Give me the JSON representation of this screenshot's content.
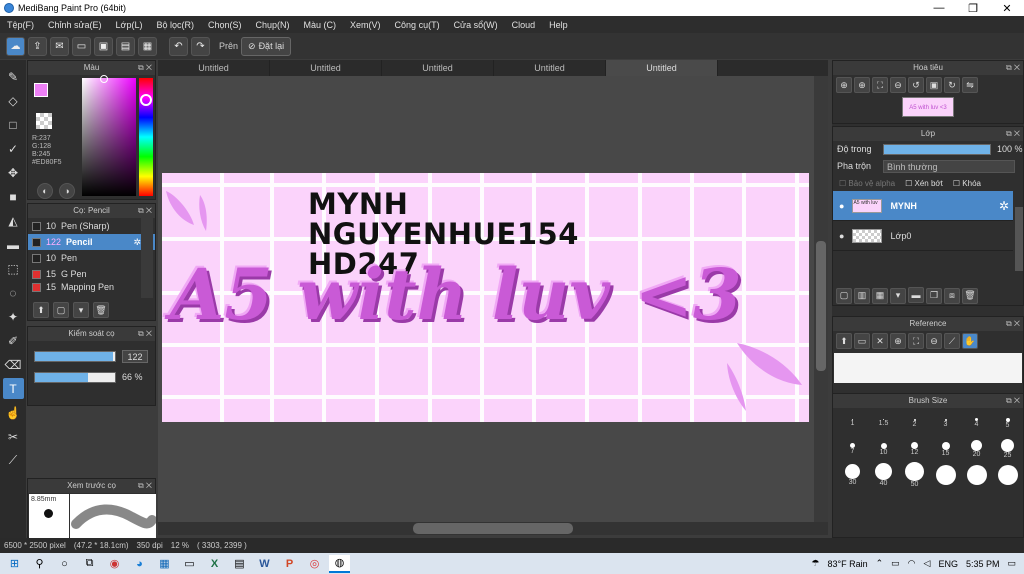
{
  "window": {
    "title": "MediBang Paint Pro (64bit)"
  },
  "menu": [
    "Tệp(F)",
    "Chỉnh sửa(E)",
    "Lớp(L)",
    "Bộ lọc(R)",
    "Chọn(S)",
    "Chụp(N)",
    "Màu (C)",
    "Xem(V)",
    "Công cụ(T)",
    "Cửa sổ(W)",
    "Cloud",
    "Help"
  ],
  "toolbar": {
    "pren": "Prên",
    "reset": "Đặt lại"
  },
  "tabs": [
    "Untitled",
    "Untitled",
    "Untitled",
    "Untitled",
    "Untitled"
  ],
  "color_panel": {
    "title": "Màu",
    "r": "R:237",
    "g": "G:128",
    "b": "B:245",
    "hex": "#ED80F5",
    "fg": "#ED80F5",
    "bg": "#F5C842"
  },
  "brush_panel": {
    "title": "Cọ: Pencil",
    "items": [
      {
        "size": "10",
        "name": "Pen (Sharp)",
        "color": "#222222"
      },
      {
        "size": "122",
        "name": "Pencil",
        "color": "#222222"
      },
      {
        "size": "10",
        "name": "Pen",
        "color": "#222222"
      },
      {
        "size": "15",
        "name": "G Pen",
        "color": "#e03030"
      },
      {
        "size": "15",
        "name": "Mapping Pen",
        "color": "#e03030"
      }
    ]
  },
  "control_panel": {
    "title": "Kiểm soát cọ",
    "size": "122",
    "opacity": "66 %",
    "size_fraction": 0.98,
    "opacity_fraction": 0.66
  },
  "preview_panel": {
    "title": "Xem trước cọ",
    "size": "8.85mm"
  },
  "canvas": {
    "line1": "MYNH",
    "line2": "NGUYENHUE154",
    "line3": "HD247",
    "headline": "A5 with luv <3"
  },
  "navigator": {
    "title": "Hoa tiêu",
    "thumb_text": "A5 with luv <3"
  },
  "layer_panel": {
    "title": "Lớp",
    "opacity_label": "Độ trong",
    "opacity_value": "100 %",
    "opacity_fraction": 1.0,
    "blend_label": "Pha trộn",
    "blend_value": "Bình thường",
    "protect_alpha": "Bảo vệ alpha",
    "clipping": "Xén bớt",
    "lock": "Khóa",
    "layers": [
      {
        "name": "MYNH",
        "thumb": "A5 with luv"
      },
      {
        "name": "Lớp0",
        "thumb": ""
      }
    ]
  },
  "reference": {
    "title": "Reference"
  },
  "brush_size": {
    "title": "Brush Size",
    "sizes": [
      "1",
      "1.5",
      "2",
      "3",
      "4",
      "5",
      "7",
      "10",
      "12",
      "15",
      "20",
      "25",
      "30",
      "40",
      "50",
      "",
      "",
      "",
      "",
      ""
    ]
  },
  "status": {
    "pixels": "6500 * 2500 pixel",
    "cm": "(47.2 * 18.1cm)",
    "dpi": "350 dpi",
    "zoom": "12 %",
    "coords": "( 3303, 2399 )"
  },
  "taskbar": {
    "weather": "83°F Rain",
    "lang": "ENG",
    "time": "5:35 PM"
  }
}
